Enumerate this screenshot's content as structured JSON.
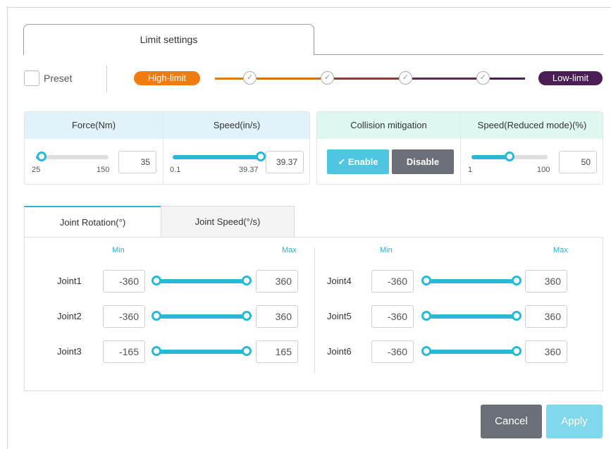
{
  "main_tab": {
    "label": "Limit settings"
  },
  "preset": {
    "label": "Preset",
    "checked": false
  },
  "levels": {
    "high": "High-limit",
    "low": "Low-limit",
    "check_glyph": "✓",
    "step_count": 4
  },
  "force": {
    "header": "Force(Nm)",
    "min": "25",
    "max": "150",
    "value": "35",
    "fraction": 0.08
  },
  "speed": {
    "header": "Speed(in/s)",
    "min": "0.1",
    "max": "39.37",
    "value": "39.37",
    "fraction": 1.0
  },
  "collision": {
    "header": "Collision mitigation",
    "enable_label": "✔ Enable",
    "disable_label": "Disable",
    "selected": "Enable"
  },
  "reduced_speed": {
    "header": "Speed(Reduced mode)(%)",
    "min": "1",
    "max": "100",
    "value": "50",
    "fraction": 0.5
  },
  "joint_tabs": {
    "rotation": "Joint Rotation(°)",
    "speed": "Joint Speed(°/s)",
    "active": "rotation"
  },
  "joint_columns": {
    "min": "Min",
    "max": "Max"
  },
  "joints_left": [
    {
      "name": "Joint1",
      "min": "-360",
      "max": "360"
    },
    {
      "name": "Joint2",
      "min": "-360",
      "max": "360"
    },
    {
      "name": "Joint3",
      "min": "-165",
      "max": "165"
    }
  ],
  "joints_right": [
    {
      "name": "Joint4",
      "min": "-360",
      "max": "360"
    },
    {
      "name": "Joint5",
      "min": "-360",
      "max": "360"
    },
    {
      "name": "Joint6",
      "min": "-360",
      "max": "360"
    }
  ],
  "actions": {
    "cancel": "Cancel",
    "apply": "Apply"
  },
  "colors": {
    "accent": "#29b9d6",
    "high_limit": "#ef7c10",
    "low_limit": "#4a1e54",
    "collision_header": "#dff7f1",
    "force_header": "#e2f2fa",
    "dark_button": "#6b7078"
  }
}
